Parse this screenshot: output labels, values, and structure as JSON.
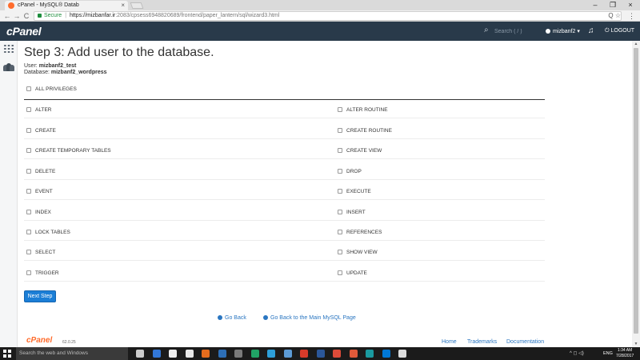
{
  "browser": {
    "tab_title": "cPanel - MySQL® Datab",
    "tab_close": "×",
    "window_controls": {
      "minimize": "–",
      "restore": "❐",
      "close": "×"
    },
    "nav": {
      "back": "←",
      "forward": "→",
      "reload": "C"
    },
    "secure_label": "Secure",
    "url_host": "https://mizbanfar.ir",
    "url_path": ":2083/cpsess6948820689/frontend/paper_lantern/sql/wizard3.html",
    "addr_icons": "Q ☆",
    "menu": "⋮"
  },
  "header": {
    "logo": "cPanel",
    "search_placeholder": "Search ( / )",
    "username": "mizbanf2",
    "logout": "LOGOUT",
    "icons": {
      "search": "⌕",
      "bell": "🔔",
      "logout": "⏻"
    }
  },
  "page": {
    "title": "Step 3: Add user to the database.",
    "user_label": "User:",
    "user_value": "mizbanf2_test",
    "database_label": "Database:",
    "database_value": "mizbanf2_wordpress",
    "all_privileges": "ALL PRIVILEGES",
    "privileges_left": [
      "ALTER",
      "CREATE",
      "CREATE TEMPORARY TABLES",
      "DELETE",
      "EVENT",
      "INDEX",
      "LOCK TABLES",
      "SELECT",
      "TRIGGER"
    ],
    "privileges_right": [
      "ALTER ROUTINE",
      "CREATE ROUTINE",
      "CREATE VIEW",
      "DROP",
      "EXECUTE",
      "INSERT",
      "REFERENCES",
      "SHOW VIEW",
      "UPDATE"
    ],
    "next_step": "Next Step",
    "go_back": "Go Back",
    "go_back_main": "Go Back to the Main MySQL Page"
  },
  "footer": {
    "logo": "cPanel",
    "version": "62.0.25",
    "links": [
      "Home",
      "Trademarks",
      "Documentation"
    ]
  },
  "scrollbar": {
    "up": "▲",
    "down": "▼"
  },
  "taskbar": {
    "search_placeholder": "Search the web and Windows",
    "language": "ENG",
    "time": "1:34 AM",
    "date": "7/28/2017",
    "tray": "^ ◻ ◁)",
    "app_colors": [
      "#cccccc",
      "#3277d8",
      "#f0f0f0",
      "#e8e8e8",
      "#e66c1d",
      "#2d6fb7",
      "#7a7a7a",
      "#21a366",
      "#2d9fd9",
      "#5c9bd6",
      "#d83b2a",
      "#2b579a",
      "#dd4b39",
      "#e05a3a",
      "#1a9aa0",
      "#0078d7",
      "#dddddd"
    ]
  }
}
